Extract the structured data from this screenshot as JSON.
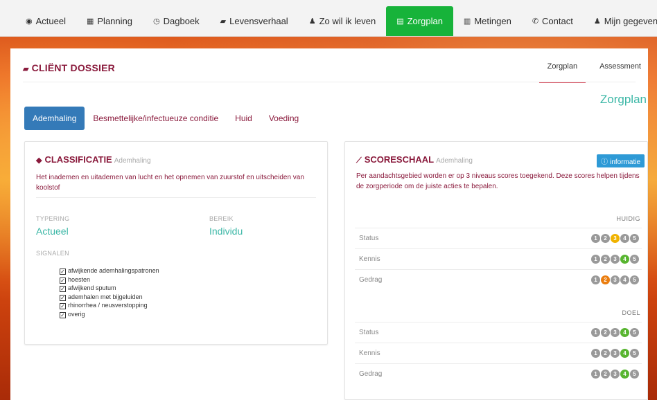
{
  "nav": [
    {
      "label": "Actueel",
      "icon": "dashboard-icon",
      "glyph": "◉",
      "active": false
    },
    {
      "label": "Planning",
      "icon": "calendar-icon",
      "glyph": "▦",
      "active": false
    },
    {
      "label": "Dagboek",
      "icon": "clock-icon",
      "glyph": "◷",
      "active": false
    },
    {
      "label": "Levensverhaal",
      "icon": "book-icon",
      "glyph": "▰",
      "active": false
    },
    {
      "label": "Zo wil ik leven",
      "icon": "user-icon",
      "glyph": "♟",
      "active": false
    },
    {
      "label": "Zorgplan",
      "icon": "document-icon",
      "glyph": "▤",
      "active": true
    },
    {
      "label": "Metingen",
      "icon": "chart-icon",
      "glyph": "▥",
      "active": false
    },
    {
      "label": "Contact",
      "icon": "phone-icon",
      "glyph": "✆",
      "active": false
    },
    {
      "label": "Mijn gegevens",
      "icon": "user-icon",
      "glyph": "♟",
      "active": false
    }
  ],
  "header": {
    "title": "CLIËNT DOSSIER",
    "tabs": [
      {
        "label": "Zorgplan",
        "active": true
      },
      {
        "label": "Assessment",
        "active": false
      }
    ],
    "section_label": "Zorgplan"
  },
  "subtabs": [
    {
      "label": "Ademhaling",
      "active": true
    },
    {
      "label": "Besmettelijke/infectueuze conditie",
      "active": false
    },
    {
      "label": "Huid",
      "active": false
    },
    {
      "label": "Voeding",
      "active": false
    }
  ],
  "classificatie": {
    "title": "CLASSIFICATIE",
    "subtitle": "Ademhaling",
    "description": "Het inademen en uitademen van lucht en het opnemen van zuurstof en uitscheiden van koolstof",
    "typering_label": "TYPERING",
    "typering_value": "Actueel",
    "bereik_label": "BEREIK",
    "bereik_value": "Individu",
    "signalen_label": "SIGNALEN",
    "signalen": [
      "afwijkende ademhalingspatronen",
      "hoesten",
      "afwijkend sputum",
      "ademhalen met bijgeluiden",
      "rhinorrhea / neusverstopping",
      "overig"
    ]
  },
  "scoreschaal": {
    "title": "SCORESCHAAL",
    "subtitle": "Ademhaling",
    "info_label": "informatie",
    "description": "Per aandachtsgebied worden er op 3 niveaus scores toegekend. Deze scores helpen tijdens de zorgperiode om de juiste acties te bepalen.",
    "huidig_label": "HUIDIG",
    "doel_label": "DOEL",
    "huidig": [
      {
        "label": "Status",
        "score": 3,
        "color": "yellow"
      },
      {
        "label": "Kennis",
        "score": 4,
        "color": "green"
      },
      {
        "label": "Gedrag",
        "score": 2,
        "color": "orange"
      }
    ],
    "doel": [
      {
        "label": "Status",
        "score": 4,
        "color": "green"
      },
      {
        "label": "Kennis",
        "score": 4,
        "color": "green"
      },
      {
        "label": "Gedrag",
        "score": 4,
        "color": "green"
      }
    ],
    "dot_numbers": [
      "1",
      "2",
      "3",
      "4",
      "5"
    ]
  },
  "colors": {
    "accent": "#8a1a3c",
    "teal": "#3bb7a6",
    "nav_active": "#17b33a",
    "tab_active": "#347ab8",
    "info": "#2e9ad6"
  }
}
